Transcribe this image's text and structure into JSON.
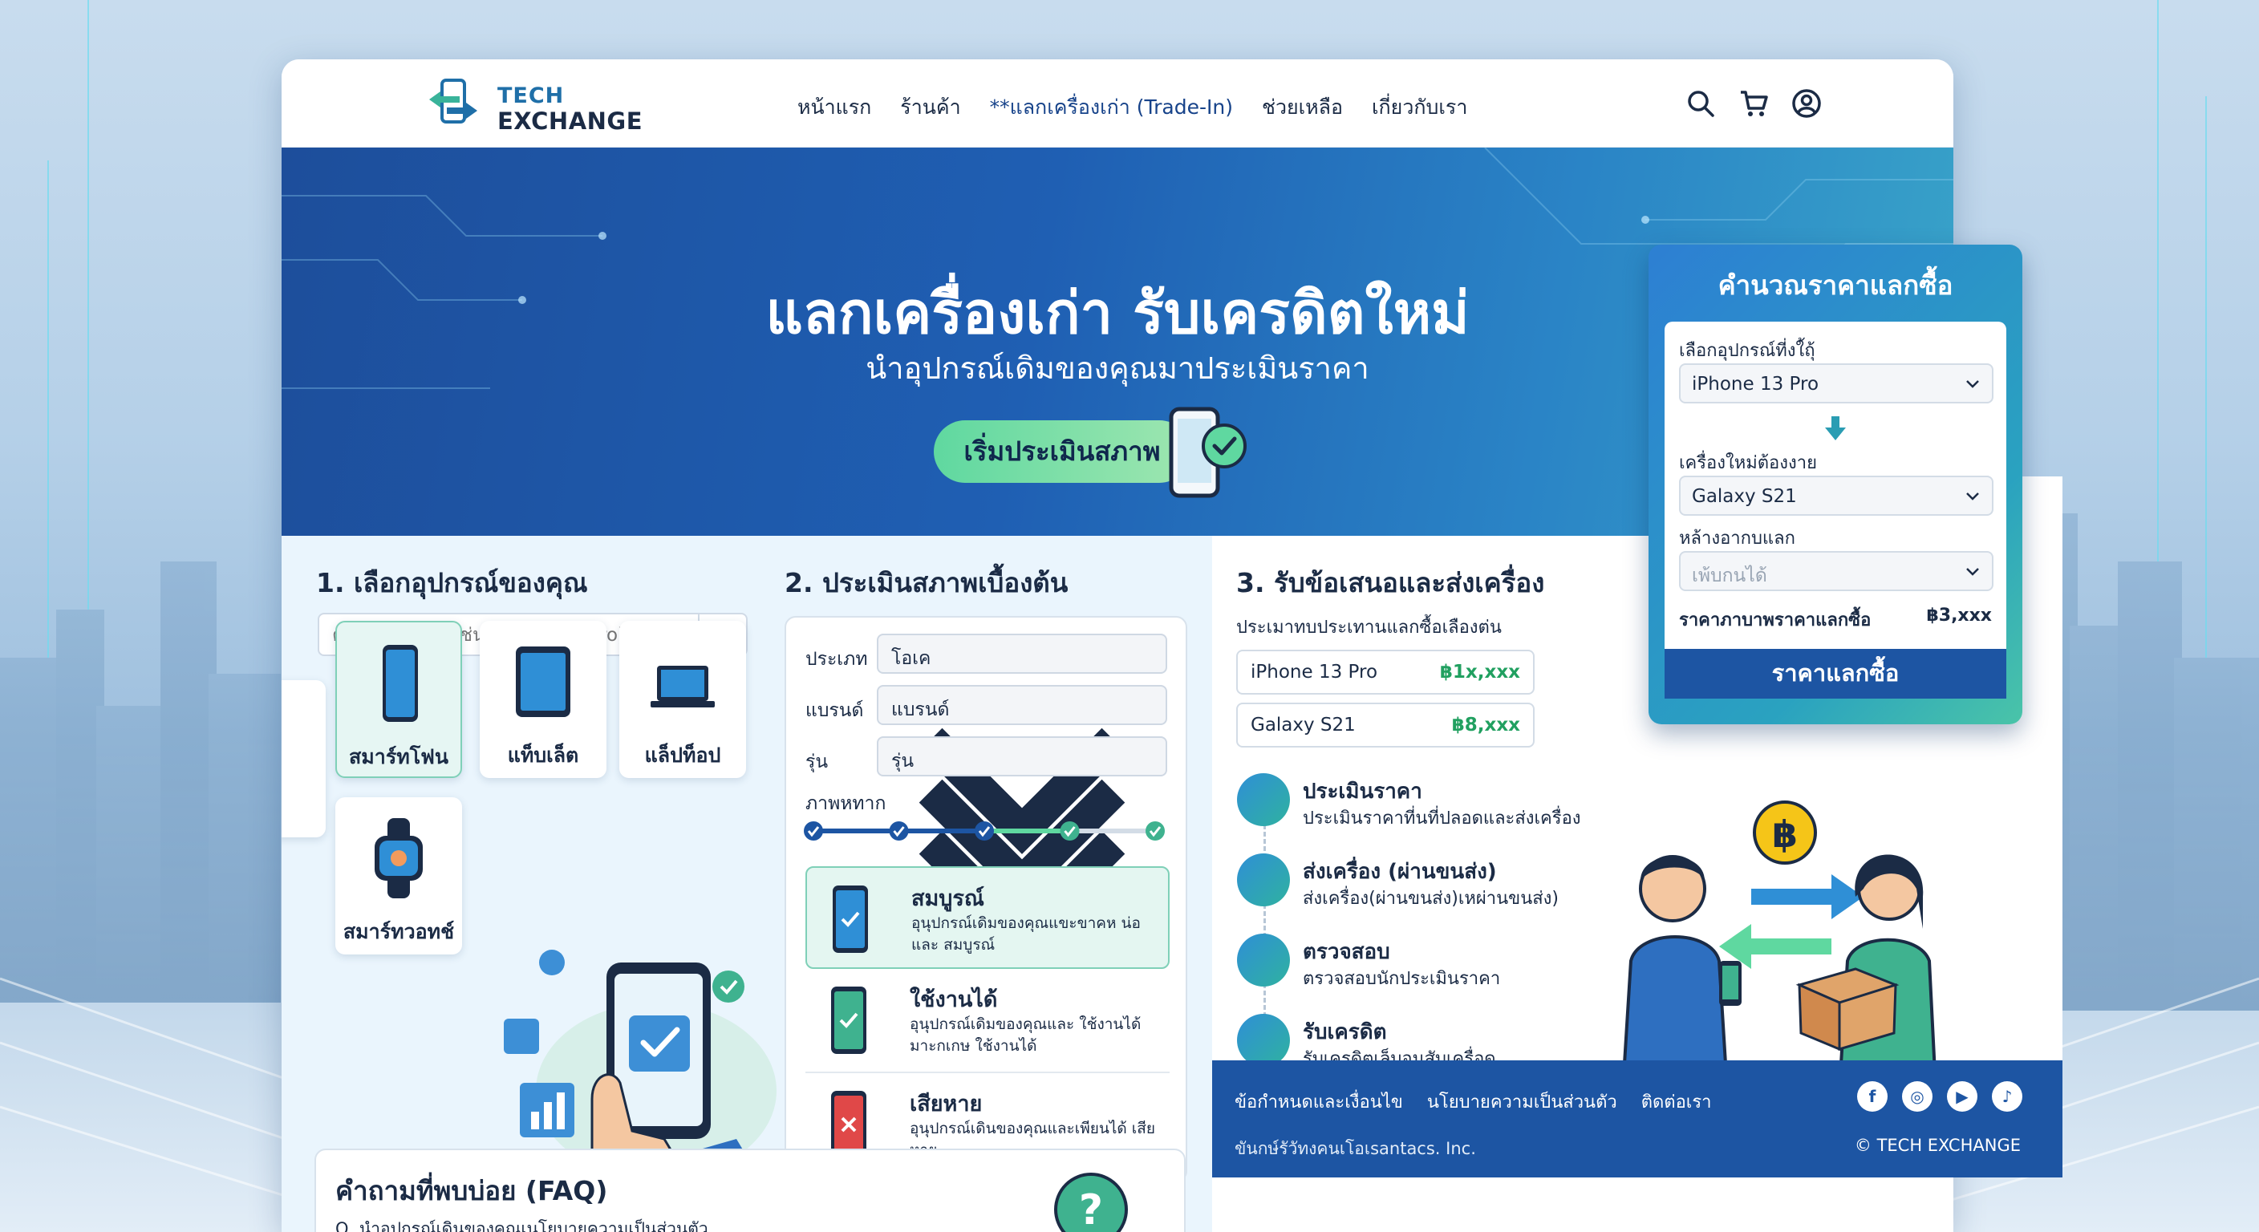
{
  "logo": {
    "line1": "TECH",
    "line2": "EXCHANGE"
  },
  "nav": [
    {
      "label": "หน้าแรก"
    },
    {
      "label": "ร้านค้า"
    },
    {
      "label": "**แลกเครื่องเก่า (Trade-In)"
    },
    {
      "label": "ช่วยเหลือ"
    },
    {
      "label": "เกี่ยวกับเรา"
    }
  ],
  "header_icons": [
    "search-icon",
    "cart-icon",
    "user-icon"
  ],
  "hero": {
    "title": "แลกเครื่องเก่า รับเครดิตใหม่",
    "subtitle": "นำอุปกรณ์เดิมของคุณมาประเมินราคา",
    "cta": "เริ่มประเมินสภาพ"
  },
  "step1": {
    "title": "1. เลือกอุปกรณ์ของคุณ",
    "search_placeholder": "ค้นหาอุปกรณ์ (เช่น iPhone 13 Pro)",
    "devices": [
      {
        "label": "สมาร์ทโฟน",
        "selected": false
      },
      {
        "label": "สมาร์ทโฟน",
        "selected": true
      },
      {
        "label": "แท็บเล็ต",
        "selected": false
      },
      {
        "label": "แล็ปท็อป",
        "selected": false
      },
      {
        "label": "สมาร์ทวอทช์",
        "selected": false
      }
    ]
  },
  "step2": {
    "title": "2. ประเมินสภาพเบื้องต้น",
    "type_label": "ประเภท",
    "type_value": "โอเค",
    "brand_label": "แบรนด์",
    "brand_value": "แบรนด์",
    "model_label": "รุ่น",
    "model_value": "รุ่น",
    "exterior_label": "ภาพหทาก",
    "progress_steps": 5,
    "progress_complete": 5,
    "conditions": [
      {
        "title": "สมบูรณ์",
        "desc": "อุนุปกรณ์เดิมของคุณแขะขาคห น่อและ สมบูรณ์",
        "status": "good",
        "selected": true
      },
      {
        "title": "ใช้งานได้",
        "desc": "อุนุปกรณ์เดิมของคุณและ ใช้งานได้ มาะกเกษ ใช้งานได้",
        "status": "ok",
        "selected": false
      },
      {
        "title": "เสียหาย",
        "desc": "อุนุปกรณ์เดินของคุณและเพียนได้ เสียหาย",
        "status": "bad",
        "selected": false
      }
    ]
  },
  "faq": {
    "title": "คำถามที่พบบ่อย (FAQ)",
    "q1": "Q. นำอุปกรณ์เดินของคุณเนโยบายความเป็นส่วนตัว"
  },
  "step3": {
    "title": "3. รับข้อเสนอและส่งเครื่อง",
    "subtitle": "ประเมาทบประเทานแลกซื้อเลืองต่น",
    "offers": [
      {
        "name": "iPhone 13 Pro",
        "price": "฿1x,xxx"
      },
      {
        "name": "Galaxy S21",
        "price": "฿8,xxx"
      }
    ],
    "steps": [
      {
        "title": "ประเมินราคา",
        "desc": "ประเมินราคาที่นที่ปลอดและส่งเครื่อง",
        "icon": "receipt-icon"
      },
      {
        "title": "ส่งเครื่อง (ผ่านขนส่ง)",
        "desc": "ส่งเครื่อง(ผ่านขนส่ง)เหผ่านขนส่ง)",
        "icon": "truck-icon"
      },
      {
        "title": "ตรวจสอบ",
        "desc": "ตรวจสอบนักประเมินราคา",
        "icon": "clipboard-icon"
      },
      {
        "title": "รับเครดิต",
        "desc": "รับเครดิตเล็บอนสับเครื่อด",
        "icon": "credit-hand-icon"
      }
    ]
  },
  "calculator": {
    "title": "คำนวณราคาแลกซื้อ",
    "device_label": "เลือกอุปกรณ์ที่งใ้ถุ้",
    "device_value": "iPhone 13 Pro",
    "new_label": "เครื่องใหม่ต้องงาย",
    "new_value": "Galaxy S21",
    "extra_label": "หล้างอากบแลก",
    "extra_placeholder": "เพ้บกนได้",
    "result_label": "ราคาภาบาพราคาแลกซื้อ",
    "result_value": "฿3,xxx",
    "button": "ราคาแลกซื้อ"
  },
  "footer": {
    "links": [
      "ข้อกำหนดและเงื่อนไข",
      "นโยบายความเป็นส่วนตัว",
      "ติดต่อเรา"
    ],
    "company": "ขันกษ์รัวัทงคนเโอเsantacs. Inc.",
    "copyright": "© TECH EXCHANGE",
    "social": [
      "facebook-icon",
      "instagram-icon",
      "youtube-icon",
      "tiktok-icon"
    ]
  },
  "colors": {
    "primary": "#1d55a3",
    "hero_start": "#1d4e9b",
    "hero_end": "#39a4c9",
    "accent_green": "#5fd8a0",
    "price_green": "#21a060"
  }
}
